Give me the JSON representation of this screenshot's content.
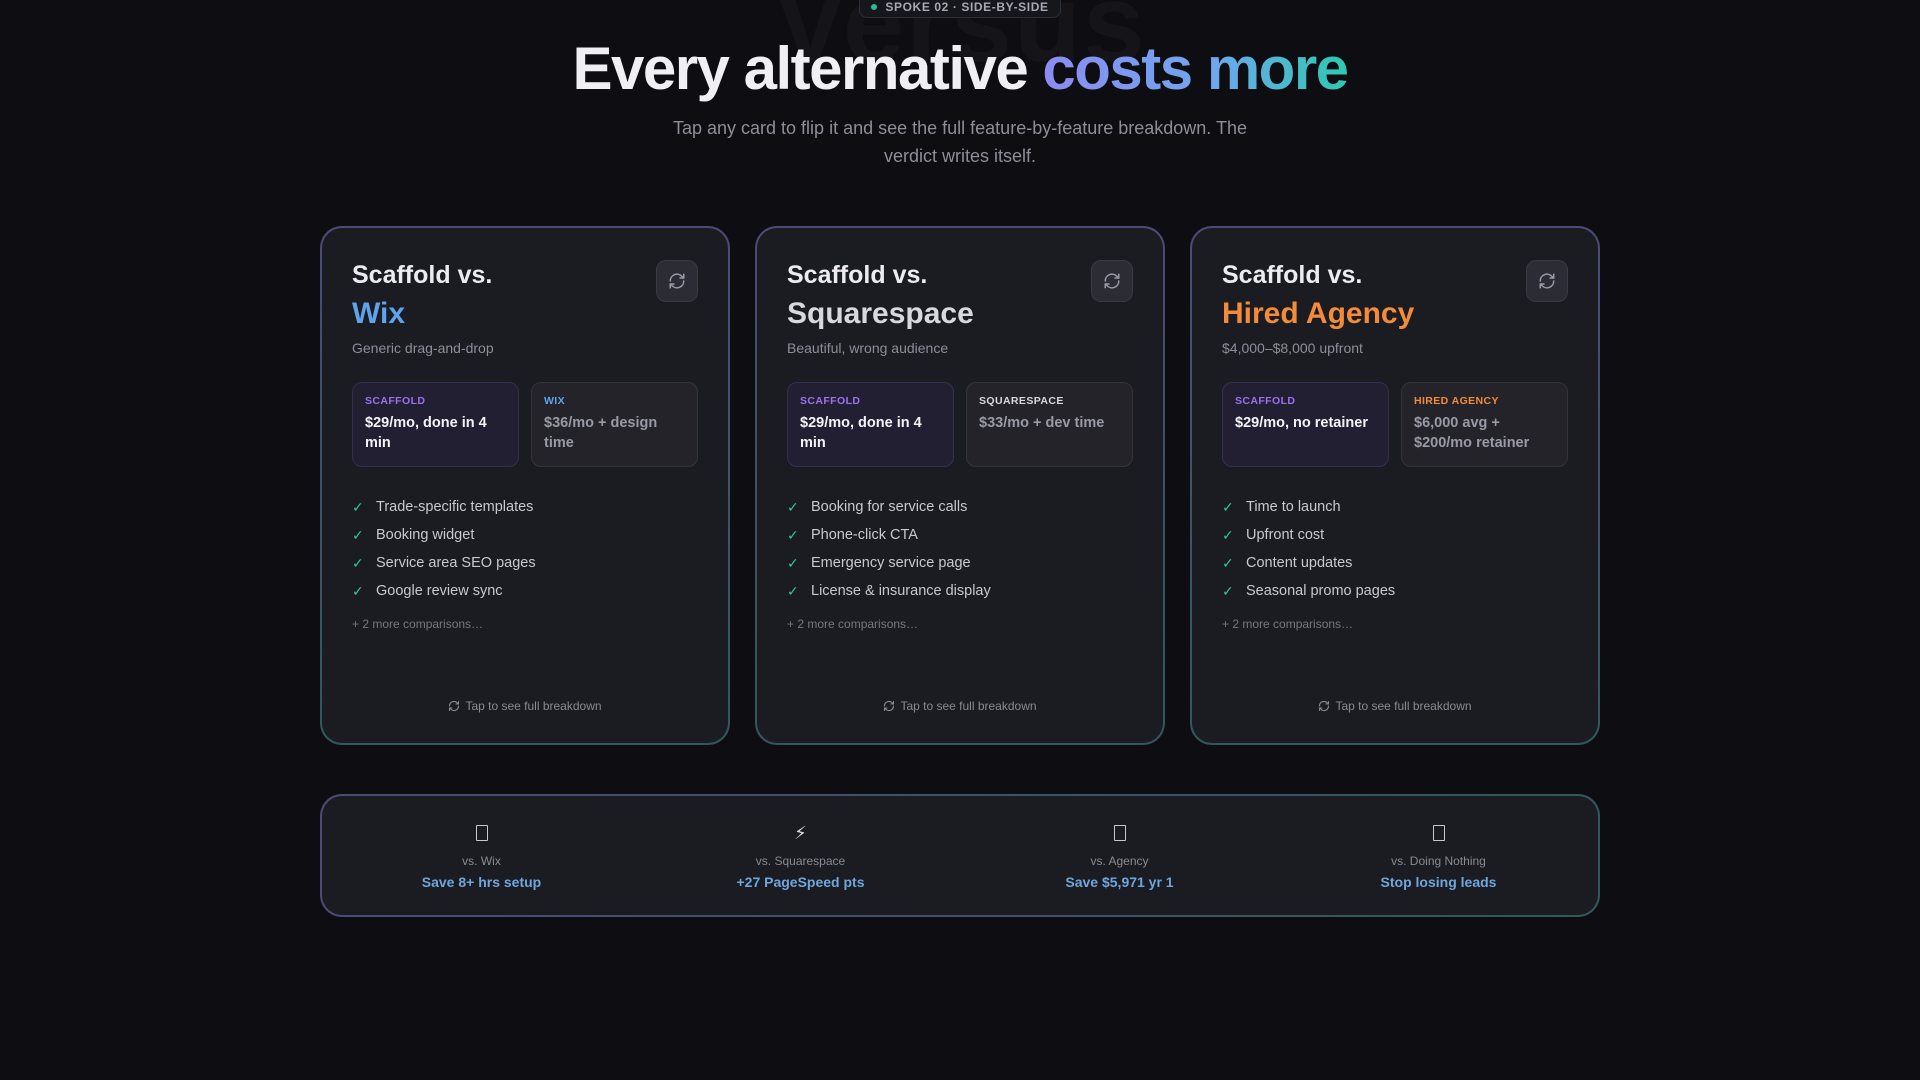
{
  "eyebrow": {
    "text": "SPOKE 02 · SIDE-BY-SIDE"
  },
  "bg_word": "Versus",
  "hero": {
    "title_plain": "Every alternative ",
    "title_accent": "costs more",
    "subtitle": "Tap any card to flip it and see the full feature-by-feature breakdown. The verdict writes itself."
  },
  "colors": {
    "wix": "#5fa3ec",
    "squarespace": "#d8d8de",
    "agency": "#f28c3a",
    "scaffold": "#9a72ec",
    "check": "#2fc99a"
  },
  "cards": [
    {
      "heading": "Scaffold vs.",
      "rival": "Wix",
      "rival_color": "#5fa3ec",
      "tagline": "Generic drag-and-drop",
      "scaffold_label": "SCAFFOLD",
      "scaffold_price": "$29/mo, done in 4 min",
      "rival_label": "WIX",
      "rival_label_color": "#5fa3ec",
      "rival_price": "$36/mo + design time",
      "features": [
        "Trade-specific templates",
        "Booking widget",
        "Service area SEO pages",
        "Google review sync"
      ],
      "more": "+ 2 more comparisons…",
      "tap": "Tap to see full breakdown"
    },
    {
      "heading": "Scaffold vs.",
      "rival": "Squarespace",
      "rival_color": "#d8d8de",
      "tagline": "Beautiful, wrong audience",
      "scaffold_label": "SCAFFOLD",
      "scaffold_price": "$29/mo, done in 4 min",
      "rival_label": "SQUARESPACE",
      "rival_label_color": "#d8d8de",
      "rival_price": "$33/mo + dev time",
      "features": [
        "Booking for service calls",
        "Phone-click CTA",
        "Emergency service page",
        "License & insurance display"
      ],
      "more": "+ 2 more comparisons…",
      "tap": "Tap to see full breakdown"
    },
    {
      "heading": "Scaffold vs.",
      "rival": "Hired Agency",
      "rival_color": "#f28c3a",
      "tagline": "$4,000–$8,000 upfront",
      "scaffold_label": "SCAFFOLD",
      "scaffold_price": "$29/mo, no retainer",
      "rival_label": "HIRED AGENCY",
      "rival_label_color": "#f28c3a",
      "rival_price": "$6,000 avg + $200/mo retainer",
      "features": [
        "Time to launch",
        "Upfront cost",
        "Content updates",
        "Seasonal promo pages"
      ],
      "more": "+ 2 more comparisons…",
      "tap": "Tap to see full breakdown"
    }
  ],
  "summary": [
    {
      "icon": "box-glyph-icon",
      "label": "vs. Wix",
      "value": "Save 8+ hrs setup"
    },
    {
      "icon": "lightning-icon",
      "label": "vs. Squarespace",
      "value": "+27 PageSpeed pts"
    },
    {
      "icon": "box-glyph-icon",
      "label": "vs. Agency",
      "value": "Save $5,971 yr 1"
    },
    {
      "icon": "box-glyph-icon",
      "label": "vs. Doing Nothing",
      "value": "Stop losing leads"
    }
  ]
}
